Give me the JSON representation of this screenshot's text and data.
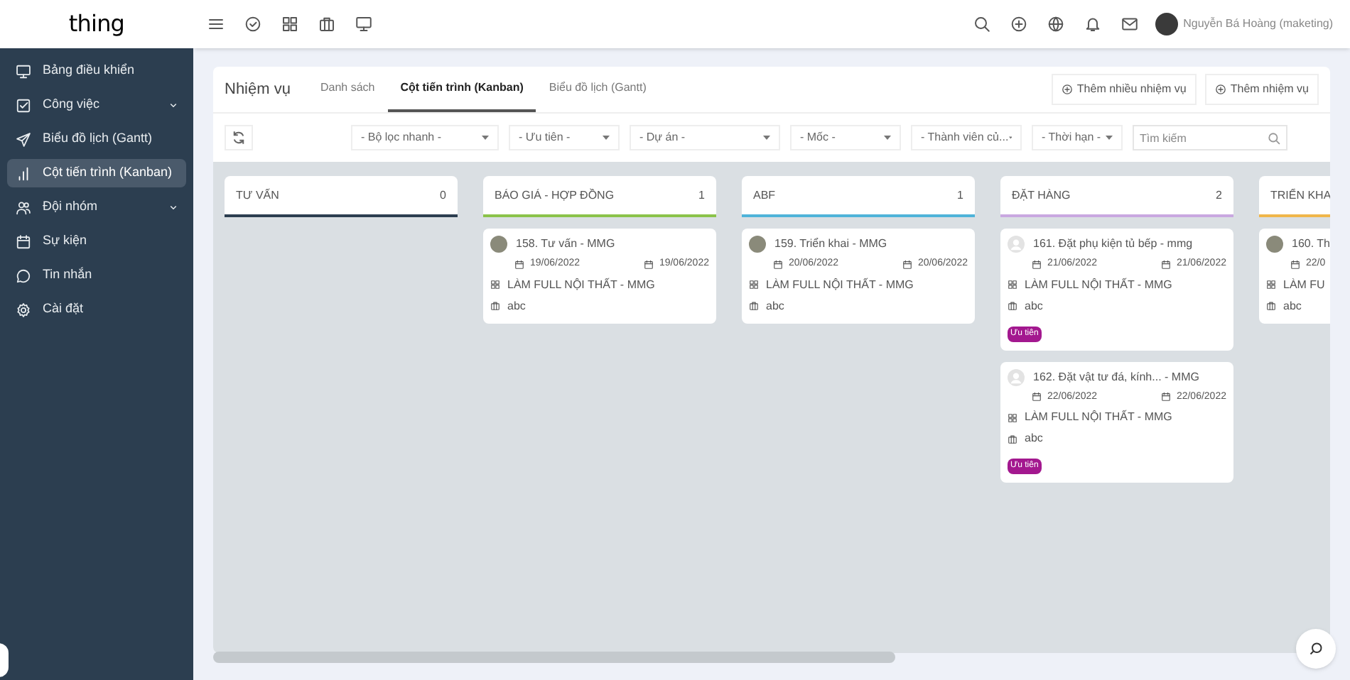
{
  "logo": {
    "text": "thing"
  },
  "sidebar": {
    "items": [
      {
        "label": "Bảng điều khiển",
        "selected": false,
        "expandable": false
      },
      {
        "label": "Công việc",
        "selected": false,
        "expandable": true
      },
      {
        "label": "Biểu đồ lịch (Gantt)",
        "selected": false,
        "expandable": false
      },
      {
        "label": "Cột tiến trình (Kanban)",
        "selected": true,
        "expandable": false
      },
      {
        "label": "Đội nhóm",
        "selected": false,
        "expandable": true
      },
      {
        "label": "Sự kiện",
        "selected": false,
        "expandable": false
      },
      {
        "label": "Tin nhắn",
        "selected": false,
        "expandable": false
      },
      {
        "label": "Cài đặt",
        "selected": false,
        "expandable": false
      }
    ]
  },
  "user": {
    "name": "Nguyễn Bá Hoàng (maketing)"
  },
  "page": {
    "title": "Nhiệm vụ",
    "tabs": [
      {
        "label": "Danh sách",
        "selected": false
      },
      {
        "label": "Cột tiến trình (Kanban)",
        "selected": true
      },
      {
        "label": "Biểu đồ lịch (Gantt)",
        "selected": false
      }
    ],
    "actions": [
      "Thêm nhiều nhiệm vụ",
      "Thêm nhiệm vụ"
    ]
  },
  "filters": [
    "- Bộ lọc nhanh -",
    "- Ưu tiên -",
    "- Dự án -",
    "- Mốc -",
    "- Thành viên củ...",
    "- Thời hạn -"
  ],
  "search": {
    "placeholder": "Tìm kiếm"
  },
  "columns": [
    {
      "title": "TƯ VẤN",
      "count": "0",
      "color": "#2c3e50"
    },
    {
      "title": "BÁO GIÁ - HỢP ĐỒNG",
      "count": "1",
      "color": "#8bc34a",
      "cards": [
        {
          "title": "158. Tư vấn - MMG",
          "kind": "photo",
          "start": "19/06/2022",
          "end": "19/06/2022",
          "project": "LÀM FULL NỘI THẤT - MMG",
          "tag": "abc"
        }
      ]
    },
    {
      "title": "ABF",
      "count": "1",
      "color": "#4fb3d9",
      "cards": [
        {
          "title": "159. Triển khai - MMG",
          "kind": "photo",
          "start": "20/06/2022",
          "end": "20/06/2022",
          "project": "LÀM FULL NỘI THẤT - MMG",
          "tag": "abc"
        }
      ]
    },
    {
      "title": "ĐẶT HÀNG",
      "count": "2",
      "color": "#c9a8e0",
      "cards": [
        {
          "title": "161. Đặt phụ kiện tủ bếp - mmg",
          "kind": "blank",
          "start": "21/06/2022",
          "end": "21/06/2022",
          "project": "LÀM FULL NỘI THẤT - MMG",
          "tag": "abc",
          "badge": "Ưu tiên"
        },
        {
          "title": "162. Đặt vật tư đá, kính... - MMG",
          "kind": "blank",
          "start": "22/06/2022",
          "end": "22/06/2022",
          "project": "LÀM FULL NỘI THẤT - MMG",
          "tag": "abc",
          "badge": "Ưu tiên"
        }
      ]
    },
    {
      "title": "TRIỂN KHA",
      "color": "#f0b64a",
      "cards": [
        {
          "title": "160. Th",
          "kind": "photo",
          "start": "22/0",
          "project": "LÀM FU",
          "tag": "abc"
        }
      ]
    }
  ]
}
